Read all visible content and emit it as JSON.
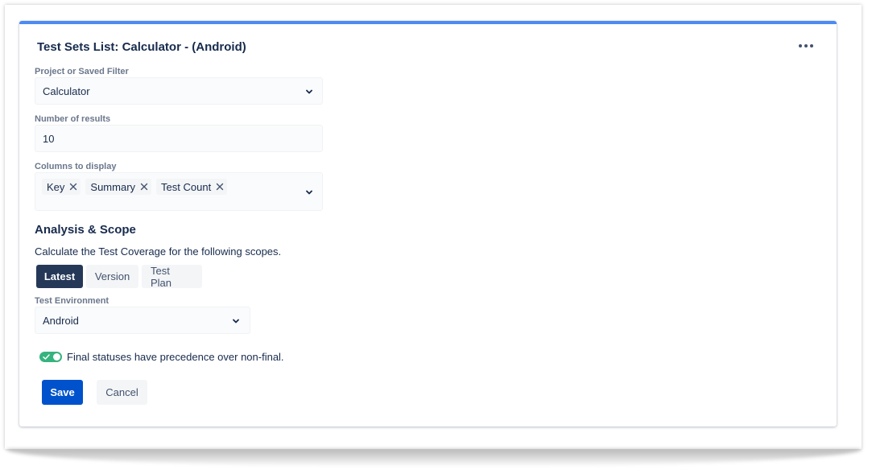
{
  "gadget": {
    "title": "Test Sets List: Calculator - (Android)",
    "menu_icon": "more-icon"
  },
  "form": {
    "project": {
      "label": "Project or Saved Filter",
      "value": "Calculator"
    },
    "results": {
      "label": "Number of results",
      "value": "10"
    },
    "columns": {
      "label": "Columns to display",
      "chips": [
        "Key",
        "Summary",
        "Test Count"
      ]
    }
  },
  "analysis": {
    "title": "Analysis & Scope",
    "description": "Calculate the Test Coverage for the following scopes.",
    "scopes": [
      {
        "label": "Latest",
        "active": true
      },
      {
        "label": "Version",
        "active": false
      },
      {
        "label": "Test Plan",
        "active": false
      }
    ],
    "environment": {
      "label": "Test Environment",
      "value": "Android"
    },
    "final_toggle": {
      "label": "Final statuses have precedence over non-final.",
      "on": true
    }
  },
  "actions": {
    "save_label": "Save",
    "cancel_label": "Cancel"
  },
  "colors": {
    "accent_bar": "#4c8bf5",
    "primary": "#0052cc",
    "active_segment": "#253858",
    "toggle_on": "#36b37e"
  }
}
